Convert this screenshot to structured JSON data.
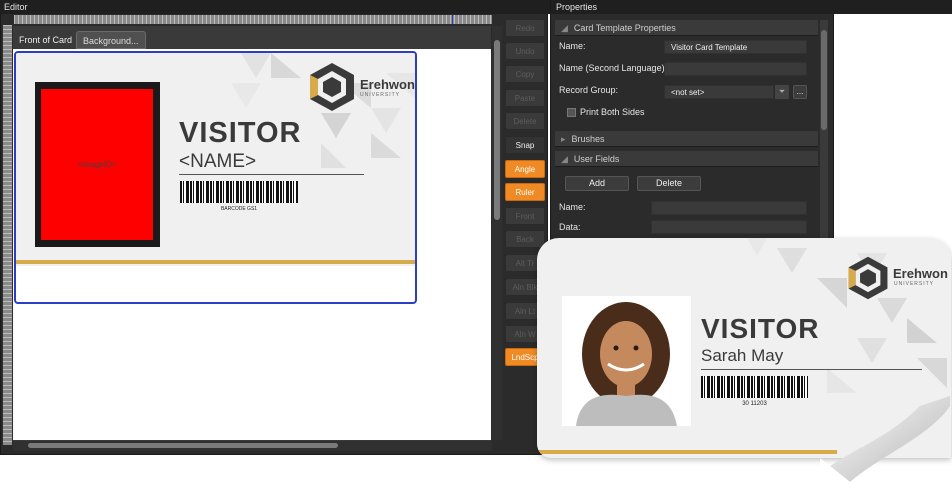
{
  "editor": {
    "title": "Editor",
    "tabs": {
      "front": "Front of Card",
      "background": "Background..."
    },
    "toolbar": [
      "Redo",
      "Undo",
      "Copy",
      "Paste",
      "Delete",
      "Snap",
      "Angle",
      "Ruler",
      "Front",
      "Back",
      "Alt Tr",
      "Aln Blk",
      "Aln Lt",
      "Aln W",
      "LndScp"
    ],
    "toolbar_states": [
      "disabled",
      "disabled",
      "disabled",
      "disabled",
      "disabled",
      "enabled",
      "orange",
      "orange",
      "disabled",
      "disabled",
      "disabled",
      "disabled",
      "disabled",
      "disabled",
      "orange"
    ]
  },
  "template_card": {
    "logo_name": "Erehwon",
    "logo_sub": "UNIVERSITY",
    "visitor": "VISITOR",
    "name_placeholder": "<NAME>",
    "image_placeholder": "<imageID>",
    "barcode_label": "BARCODE GS1"
  },
  "properties": {
    "title": "Properties",
    "section_card_template": "Card Template Properties",
    "name_label": "Name:",
    "name_value": "Visitor Card Template",
    "name2_label": "Name (Second Language):",
    "name2_value": "",
    "record_group_label": "Record Group:",
    "record_group_value": "<not set>",
    "record_group_more": "...",
    "print_both_sides": "Print Both Sides",
    "section_brushes": "Brushes",
    "section_user_fields": "User Fields",
    "add_button": "Add",
    "delete_button": "Delete",
    "uf_name_label": "Name:",
    "uf_data_label": "Data:"
  },
  "printed_card": {
    "logo_name": "Erehwon",
    "logo_sub": "UNIVERSITY",
    "visitor": "VISITOR",
    "name": "Sarah May",
    "barcode_number": "30 11203"
  },
  "colors": {
    "accent_orange": "#f08a24",
    "gold_stripe": "#d7aa4c",
    "selection_blue": "#2a3fc5",
    "photo_placeholder": "#ff0000"
  }
}
